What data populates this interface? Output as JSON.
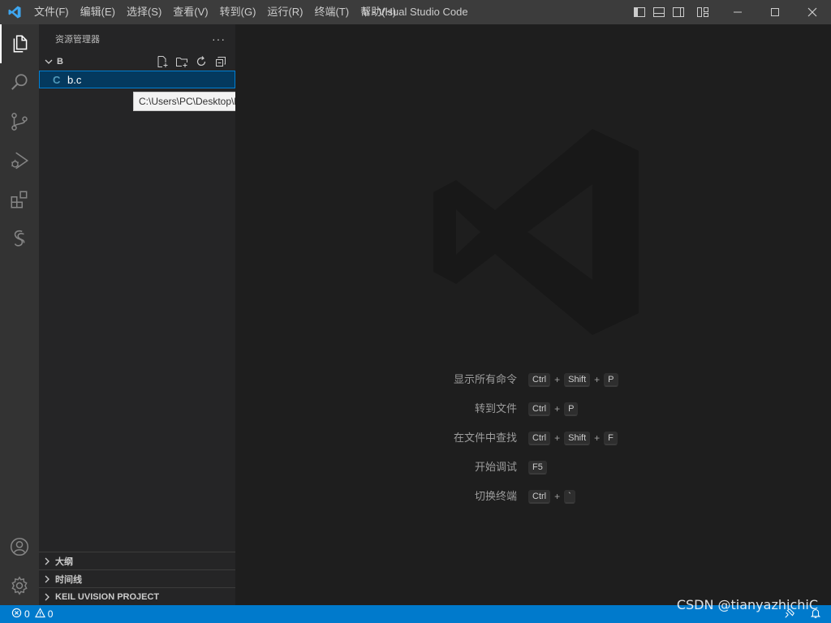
{
  "titlebar": {
    "title": "b - Visual Studio Code",
    "menu": [
      "文件(F)",
      "编辑(E)",
      "选择(S)",
      "查看(V)",
      "转到(G)",
      "运行(R)",
      "终端(T)",
      "帮助(H)"
    ]
  },
  "explorer": {
    "title": "资源管理器",
    "more": "···",
    "folder": "B",
    "files": [
      {
        "icon_text": "C",
        "name": "b.c",
        "selected": true
      }
    ],
    "tooltip": "C:\\Users\\PC\\Desktop\\b\\b.c"
  },
  "panels": [
    "大纲",
    "时间线",
    "KEIL UVISION PROJECT"
  ],
  "shortcuts": [
    {
      "label": "显示所有命令",
      "keys": [
        "Ctrl",
        "Shift",
        "P"
      ]
    },
    {
      "label": "转到文件",
      "keys": [
        "Ctrl",
        "P"
      ]
    },
    {
      "label": "在文件中查找",
      "keys": [
        "Ctrl",
        "Shift",
        "F"
      ]
    },
    {
      "label": "开始调试",
      "keys": [
        "F5"
      ]
    },
    {
      "label": "切换终端",
      "keys": [
        "Ctrl",
        "`"
      ]
    }
  ],
  "statusbar": {
    "errors": "0",
    "warnings": "0"
  },
  "watermark_text": "CSDN @tianyazhichiC",
  "colors": {
    "accent": "#007acc",
    "titlebar": "#3c3c3c",
    "activitybar": "#333333",
    "sidebar": "#252526",
    "editor": "#1e1e1e",
    "selection": "#04395e",
    "c_icon": "#519aba"
  },
  "icons": {
    "activitybar": [
      "explorer-icon",
      "search-icon",
      "source-control-icon",
      "run-debug-icon",
      "extensions-icon",
      "remote-icon",
      "account-icon",
      "manage-gear-icon"
    ],
    "folder_actions": [
      "new-file-icon",
      "new-folder-icon",
      "refresh-icon",
      "collapse-all-icon"
    ]
  }
}
